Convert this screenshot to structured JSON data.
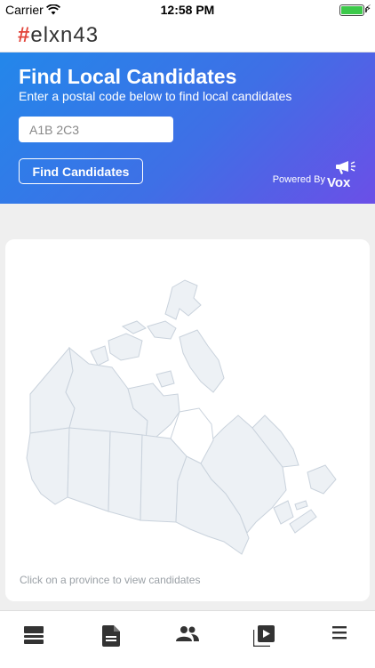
{
  "status_bar": {
    "carrier": "Carrier",
    "time": "12:58 PM",
    "icons": [
      "wifi-icon",
      "battery-icon",
      "charging-bolt-icon"
    ]
  },
  "app": {
    "logo_hash": "#",
    "logo_text": "elxn43"
  },
  "hero": {
    "title": "Find Local Candidates",
    "subtitle": "Enter a postal code below to find local candidates",
    "postal_input": {
      "placeholder": "A1B 2C3",
      "value": ""
    },
    "find_button": "Find Candidates",
    "powered_by": "Powered By",
    "brand": "Vox",
    "colors": {
      "gradient_start": "#2387ea",
      "gradient_end": "#6b4fe7"
    }
  },
  "map_card": {
    "hint": "Click on a province to view candidates",
    "map_fill": "#edf1f5",
    "map_stroke": "#c9d2dc"
  },
  "tab_bar": {
    "tabs": [
      {
        "icon": "news-feed-icon"
      },
      {
        "icon": "document-icon"
      },
      {
        "icon": "candidates-icon"
      },
      {
        "icon": "video-playlist-icon"
      },
      {
        "icon": "menu-icon"
      }
    ]
  }
}
